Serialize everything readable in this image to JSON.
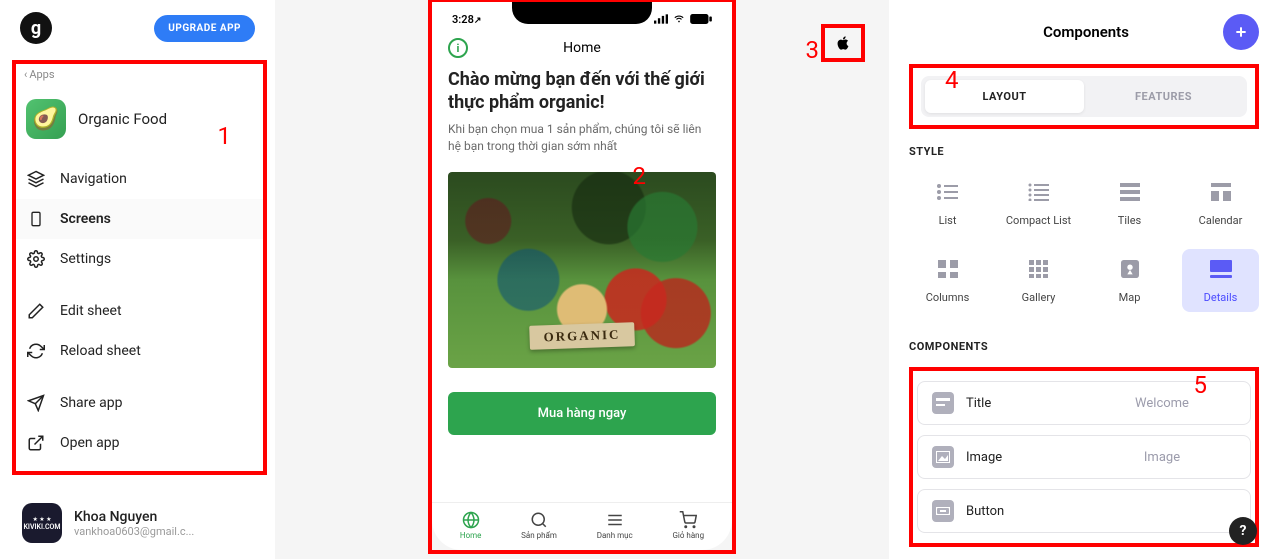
{
  "leftPanel": {
    "logoLetter": "g",
    "upgrade": "UPGRADE APP",
    "appsBack": "Apps",
    "appName": "Organic Food",
    "badge1": "1",
    "nav": {
      "navigation": "Navigation",
      "screens": "Screens",
      "settings": "Settings",
      "editSheet": "Edit sheet",
      "reloadSheet": "Reload sheet",
      "shareApp": "Share app",
      "openApp": "Open app"
    },
    "user": {
      "name": "Khoa Nguyen",
      "email": "vankhoa0603@gmail.c..."
    }
  },
  "phone": {
    "time": "3:28",
    "arrow": "↗",
    "headerTitle": "Home",
    "welcomeTitle": "Chào mừng bạn đến với thế giới thực phẩm organic!",
    "welcomeSub": "Khi bạn chọn mua 1 sản phẩm, chúng tôi sẽ liên hệ bạn trong thời gian sớm nhất",
    "badge2": "2",
    "organicLabel": "ORGANIC",
    "buyBtn": "Mua hàng ngay",
    "tabs": {
      "home": "Home",
      "sanpham": "Sản phẩm",
      "danhmuc": "Danh mục",
      "giohang": "Giỏ hàng"
    }
  },
  "platform": {
    "badge3": "3"
  },
  "rightPanel": {
    "title": "Components",
    "toggle": {
      "layout": "LAYOUT",
      "features": "FEATURES",
      "badge4": "4"
    },
    "styleLabel": "STYLE",
    "styles": {
      "list": "List",
      "compactList": "Compact List",
      "tiles": "Tiles",
      "calendar": "Calendar",
      "columns": "Columns",
      "gallery": "Gallery",
      "map": "Map",
      "details": "Details"
    },
    "componentsLabel": "COMPONENTS",
    "badge5": "5",
    "items": {
      "title": {
        "label": "Title",
        "value": "Welcome"
      },
      "image": {
        "label": "Image",
        "value": "Image"
      },
      "button": {
        "label": "Button",
        "value": ""
      }
    },
    "help": "?"
  }
}
